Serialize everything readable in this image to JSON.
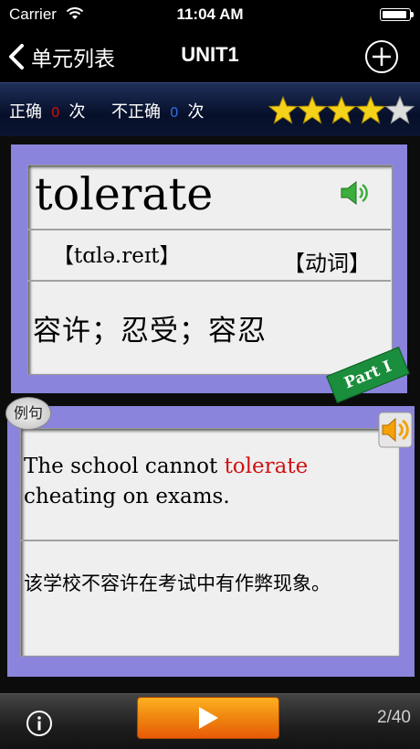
{
  "status": {
    "carrier": "Carrier",
    "time": "11:04 AM"
  },
  "nav": {
    "back_label": "单元列表",
    "title": "UNIT1"
  },
  "score": {
    "correct_label": "正确",
    "correct_count": "0",
    "times_label": "次",
    "incorrect_label": "不正确",
    "incorrect_count": "0"
  },
  "rating": {
    "filled": 4,
    "total": 5,
    "star_color": "#f5d21a",
    "empty_color": "#dddddd"
  },
  "word": {
    "text": "tolerate",
    "phonetic": "【tɑlə.reɪt】",
    "pos": "【动词】",
    "meaning": "容许；忍受；容忍"
  },
  "part_badge": "Part I",
  "example": {
    "badge": "例句",
    "en_before": "The school cannot ",
    "en_highlight": "tolerate",
    "en_after": " cheating on exams.",
    "cn": "该学校不容许在考试中有作弊现象。"
  },
  "footer": {
    "counter": "2/40"
  },
  "icons": [
    "wifi-icon",
    "battery-icon",
    "back-chevron-icon",
    "add-icon",
    "star-icon",
    "speaker-icon",
    "info-icon",
    "play-icon"
  ],
  "colors": {
    "card": "#8a84dc",
    "highlight": "#d01010",
    "play": "#f08a10"
  }
}
